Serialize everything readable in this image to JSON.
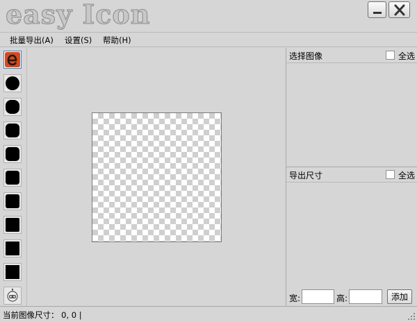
{
  "window": {
    "title": "easy Icon",
    "minimize_icon": "minimize-icon",
    "close_icon": "close-icon"
  },
  "menu": {
    "items": [
      {
        "label": "批量导出(A)"
      },
      {
        "label": "设置(S)"
      },
      {
        "label": "帮助(H)"
      }
    ]
  },
  "toolbar": {
    "tools": [
      {
        "icon": "app-logo-icon",
        "selected": true
      },
      {
        "icon": "circle-shape-icon"
      },
      {
        "icon": "rounded-square-large-icon"
      },
      {
        "icon": "rounded-square-medium-icon"
      },
      {
        "icon": "rounded-square-icon"
      },
      {
        "icon": "rounded-square-small-icon"
      },
      {
        "icon": "square-round-corner-icon"
      },
      {
        "icon": "square-slight-corner-icon"
      },
      {
        "icon": "square-tiny-corner-icon"
      },
      {
        "icon": "square-icon"
      },
      {
        "icon": "robot-icon"
      }
    ]
  },
  "select_panel": {
    "title": "选择图像",
    "select_all": "全选"
  },
  "export_panel": {
    "title": "导出尺寸",
    "select_all": "全选",
    "width_label": "宽:",
    "height_label": "高:",
    "width_value": "",
    "height_value": "",
    "add_button": "添加"
  },
  "status": {
    "text": "当前图像尺寸： 0, 0 |"
  },
  "colors": {
    "background": "#d6d6d6",
    "accent": "#3d7fc7",
    "logo_red": "#d64a1a"
  }
}
